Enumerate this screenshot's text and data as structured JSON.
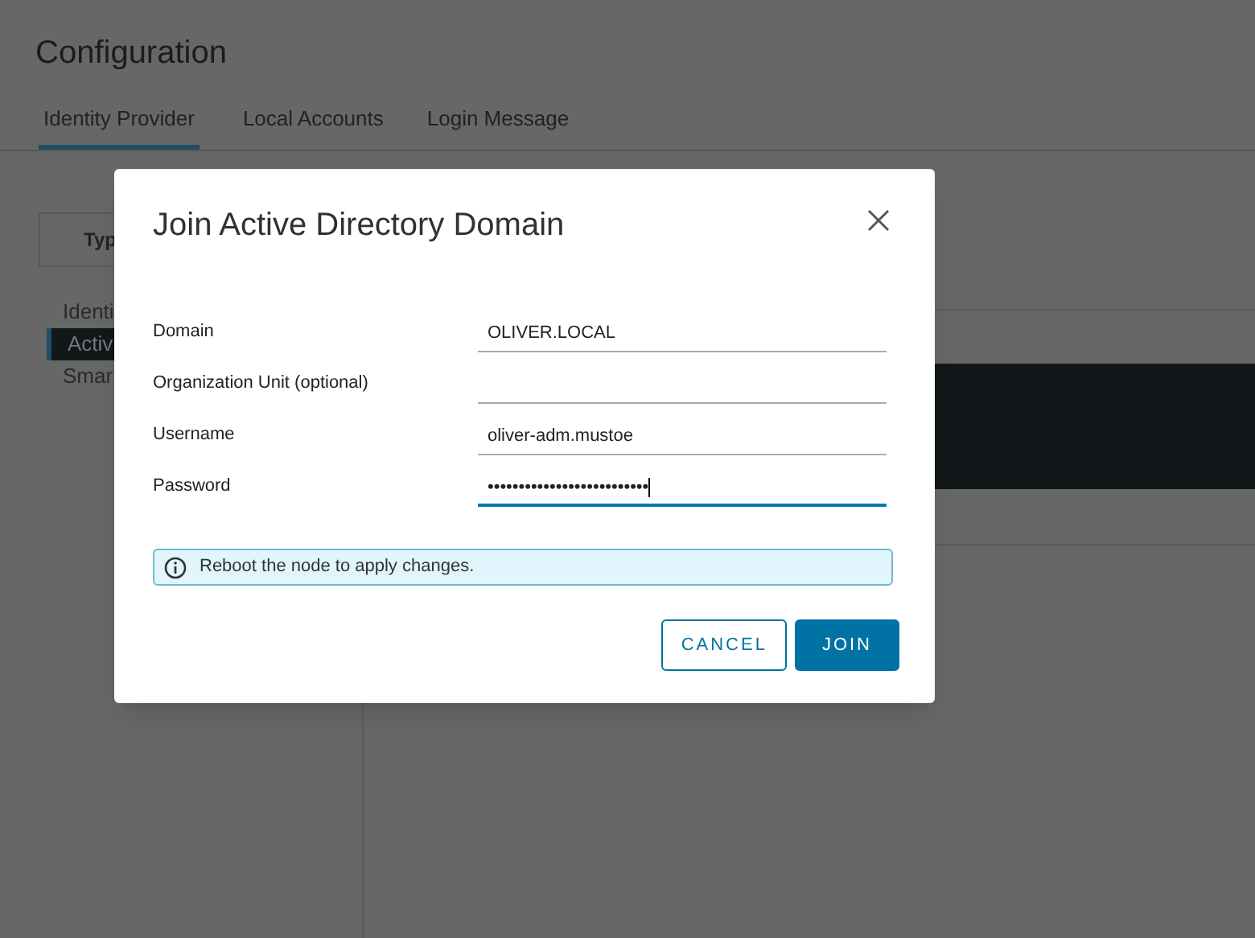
{
  "page": {
    "title": "Configuration",
    "tabs": [
      {
        "label": "Identity Provider",
        "selected": true
      },
      {
        "label": "Local Accounts",
        "selected": false
      },
      {
        "label": "Login Message",
        "selected": false
      }
    ],
    "table_header": "Typ",
    "list_items": [
      {
        "label": "Identi",
        "selected": false
      },
      {
        "label": "Activ",
        "selected": true
      },
      {
        "label": "Smar",
        "selected": false
      }
    ]
  },
  "dialog": {
    "title": "Join Active Directory Domain",
    "fields": [
      {
        "label": "Domain",
        "value": "OLIVER.LOCAL",
        "focused": false
      },
      {
        "label": "Organization Unit (optional)",
        "focused": false
      },
      {
        "label": "Username",
        "value": "oliver-adm.mustoe",
        "focused": false
      },
      {
        "label": "Password",
        "value": "••••••••••••••••••••••••••",
        "focused": true
      }
    ],
    "alert": "Reboot the node to apply changes.",
    "buttons": [
      {
        "label": "CANCEL",
        "kind": "secondary"
      },
      {
        "label": "JOIN",
        "kind": "primary"
      }
    ]
  }
}
